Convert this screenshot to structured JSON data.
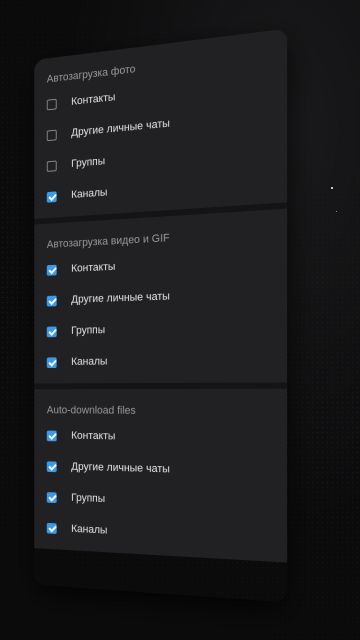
{
  "colors": {
    "background": "#0b0b0c",
    "panel": "#212123",
    "accent": "#3b9ae8",
    "text": "#e6e6e8",
    "section_title": "#9a9a9d"
  },
  "sections": [
    {
      "title": "Автозагрузка фото",
      "items": [
        {
          "label": "Контакты",
          "checked": false
        },
        {
          "label": "Другие личные чаты",
          "checked": false
        },
        {
          "label": "Группы",
          "checked": false
        },
        {
          "label": "Каналы",
          "checked": true
        }
      ]
    },
    {
      "title": "Автозагрузка видео и GIF",
      "items": [
        {
          "label": "Контакты",
          "checked": true
        },
        {
          "label": "Другие личные чаты",
          "checked": true
        },
        {
          "label": "Группы",
          "checked": true
        },
        {
          "label": "Каналы",
          "checked": true
        }
      ]
    },
    {
      "title": "Auto-download files",
      "items": [
        {
          "label": "Контакты",
          "checked": true
        },
        {
          "label": "Другие личные чаты",
          "checked": true
        },
        {
          "label": "Группы",
          "checked": true
        },
        {
          "label": "Каналы",
          "checked": true
        }
      ]
    }
  ]
}
